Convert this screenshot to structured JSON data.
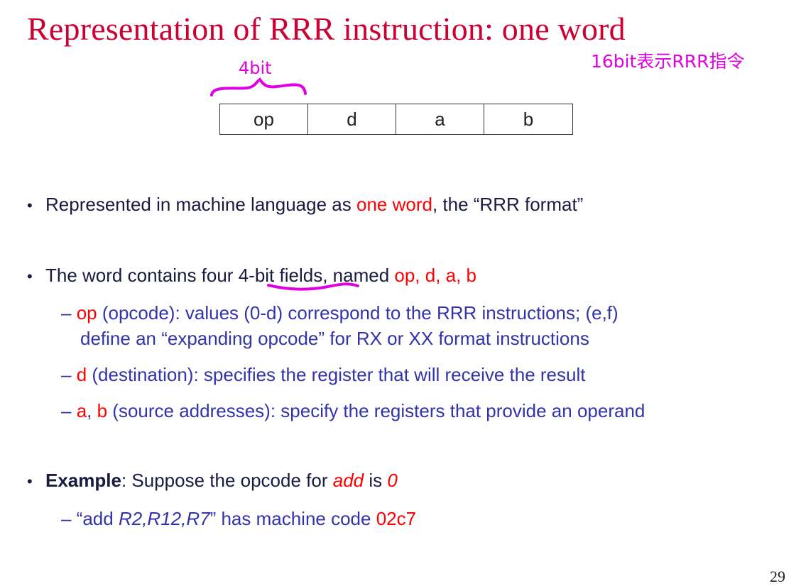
{
  "slide": {
    "title": "Representation of RRR instruction: one word",
    "page_number": "29"
  },
  "annotations": {
    "bit_width": "4bit",
    "word_note": "16bit表示RRR指令"
  },
  "format_fields": [
    "op",
    "d",
    "a",
    "b"
  ],
  "bullets": {
    "b1": {
      "prefix": "Represented in machine language",
      "as": " as ",
      "one_word": "one word",
      "suffix": ", the “RRR format”"
    },
    "b2": {
      "prefix": "The word contains four ",
      "fields": "4-bit fields",
      "mid": ", named ",
      "names": "op, d, a, b",
      "sub1": {
        "dash": "– ",
        "key": "op",
        "line1": " (opcode): values (0-d) correspond to the RRR instructions; (e,f)",
        "line2": "define an “expanding opcode” for RX or XX format instructions"
      },
      "sub2": {
        "dash": "– ",
        "key": "d",
        "text": " (destination): specifies the register that will receive the result"
      },
      "sub3": {
        "dash": "– ",
        "key_a": "a",
        "comma": ", ",
        "key_b": "b",
        "text": " (source addresses): specify the registers that provide an operand"
      }
    },
    "b3": {
      "bold": "Example",
      "text": ": Suppose the opcode for ",
      "add": "add",
      "is": " is ",
      "zero": "0",
      "sub": {
        "dash": "– ",
        "quote_open": "“add ",
        "regs": "R2,R12,R7",
        "quote_close": "” has machine code ",
        "code": "02c7"
      }
    }
  }
}
